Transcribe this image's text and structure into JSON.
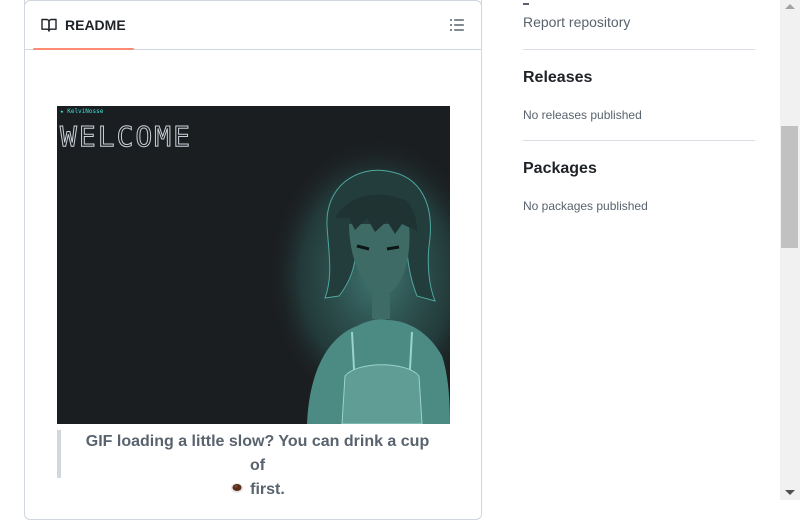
{
  "readme": {
    "tab_label": "README",
    "icons": {
      "tab": "book-icon",
      "outline": "list-unordered-icon"
    },
    "image": {
      "tag_text": "★ KelviNosse",
      "title_text": "WELCOME"
    },
    "caption": {
      "line1": "GIF loading a little slow? You can drink a cup of",
      "line2": "first.",
      "icon": "coffee-icon"
    }
  },
  "sidebar": {
    "report_label": "Report repository",
    "releases": {
      "heading": "Releases",
      "empty_text": "No releases published"
    },
    "packages": {
      "heading": "Packages",
      "empty_text": "No packages published"
    }
  },
  "colors": {
    "tab_underline": "#fd8c73",
    "border": "#d0d7de",
    "muted_text": "#59636e",
    "image_bg": "#1b1e20",
    "image_accent": "#3fe0d8"
  }
}
